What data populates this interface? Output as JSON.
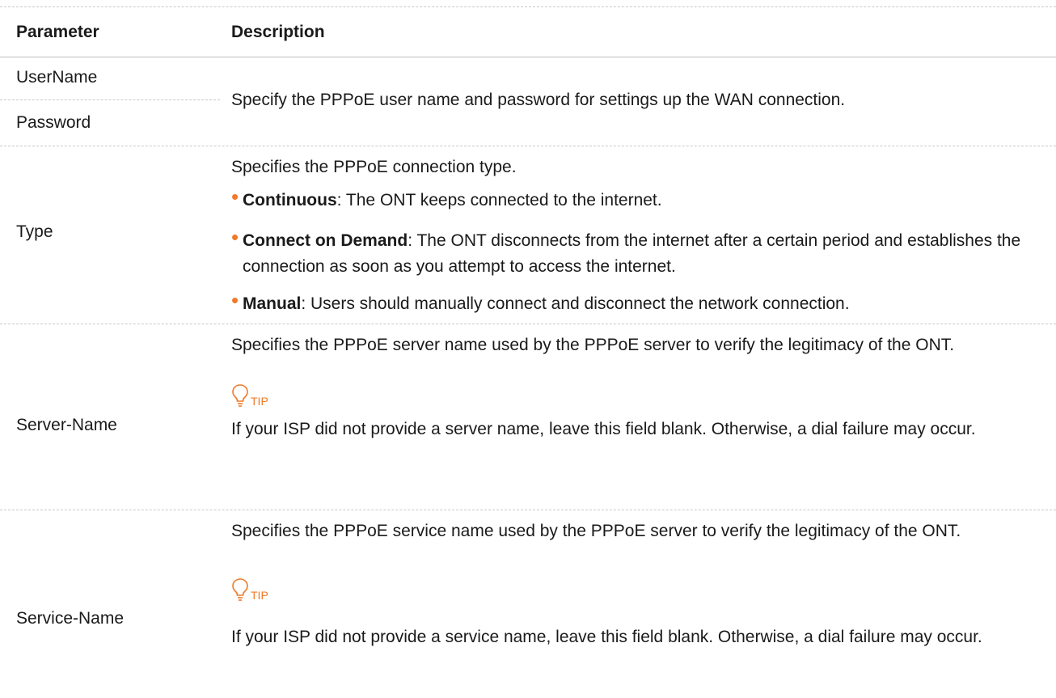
{
  "header": {
    "parameter": "Parameter",
    "description": "Description"
  },
  "rows": {
    "username": {
      "param": "UserName"
    },
    "password": {
      "param": "Password"
    },
    "credentials_desc": "Specify the PPPoE user name and password for settings up the WAN connection.",
    "type": {
      "param": "Type",
      "intro": "Specifies the PPPoE connection type.",
      "bullets": [
        {
          "term": "Continuous",
          "text": ": The ONT keeps connected to the internet."
        },
        {
          "term": "Connect on Demand",
          "text": ": The ONT disconnects from the internet after a certain period and establishes the connection as soon as you attempt to access the internet."
        },
        {
          "term": "Manual",
          "text": ": Users should manually connect and disconnect the network connection."
        }
      ]
    },
    "server_name": {
      "param": "Server-Name",
      "desc": "Specifies the PPPoE server name used by the PPPoE server to verify the legitimacy of the ONT.",
      "tip_label": "TIP",
      "tip_text": "If your ISP did not provide a server name, leave this field blank. Otherwise, a dial failure may occur."
    },
    "service_name": {
      "param": "Service-Name",
      "desc": "Specifies the PPPoE service name used by the PPPoE server to verify the legitimacy of the ONT.",
      "tip_label": "TIP",
      "tip_text": "If your ISP did not provide a service name, leave this field blank. Otherwise, a dial failure may occur."
    }
  },
  "colors": {
    "accent": "#f07a28",
    "divider": "#c8c8c8",
    "text": "#1a1a1a"
  },
  "icons": {
    "tip": "lightbulb-icon",
    "bullet": "dot"
  }
}
